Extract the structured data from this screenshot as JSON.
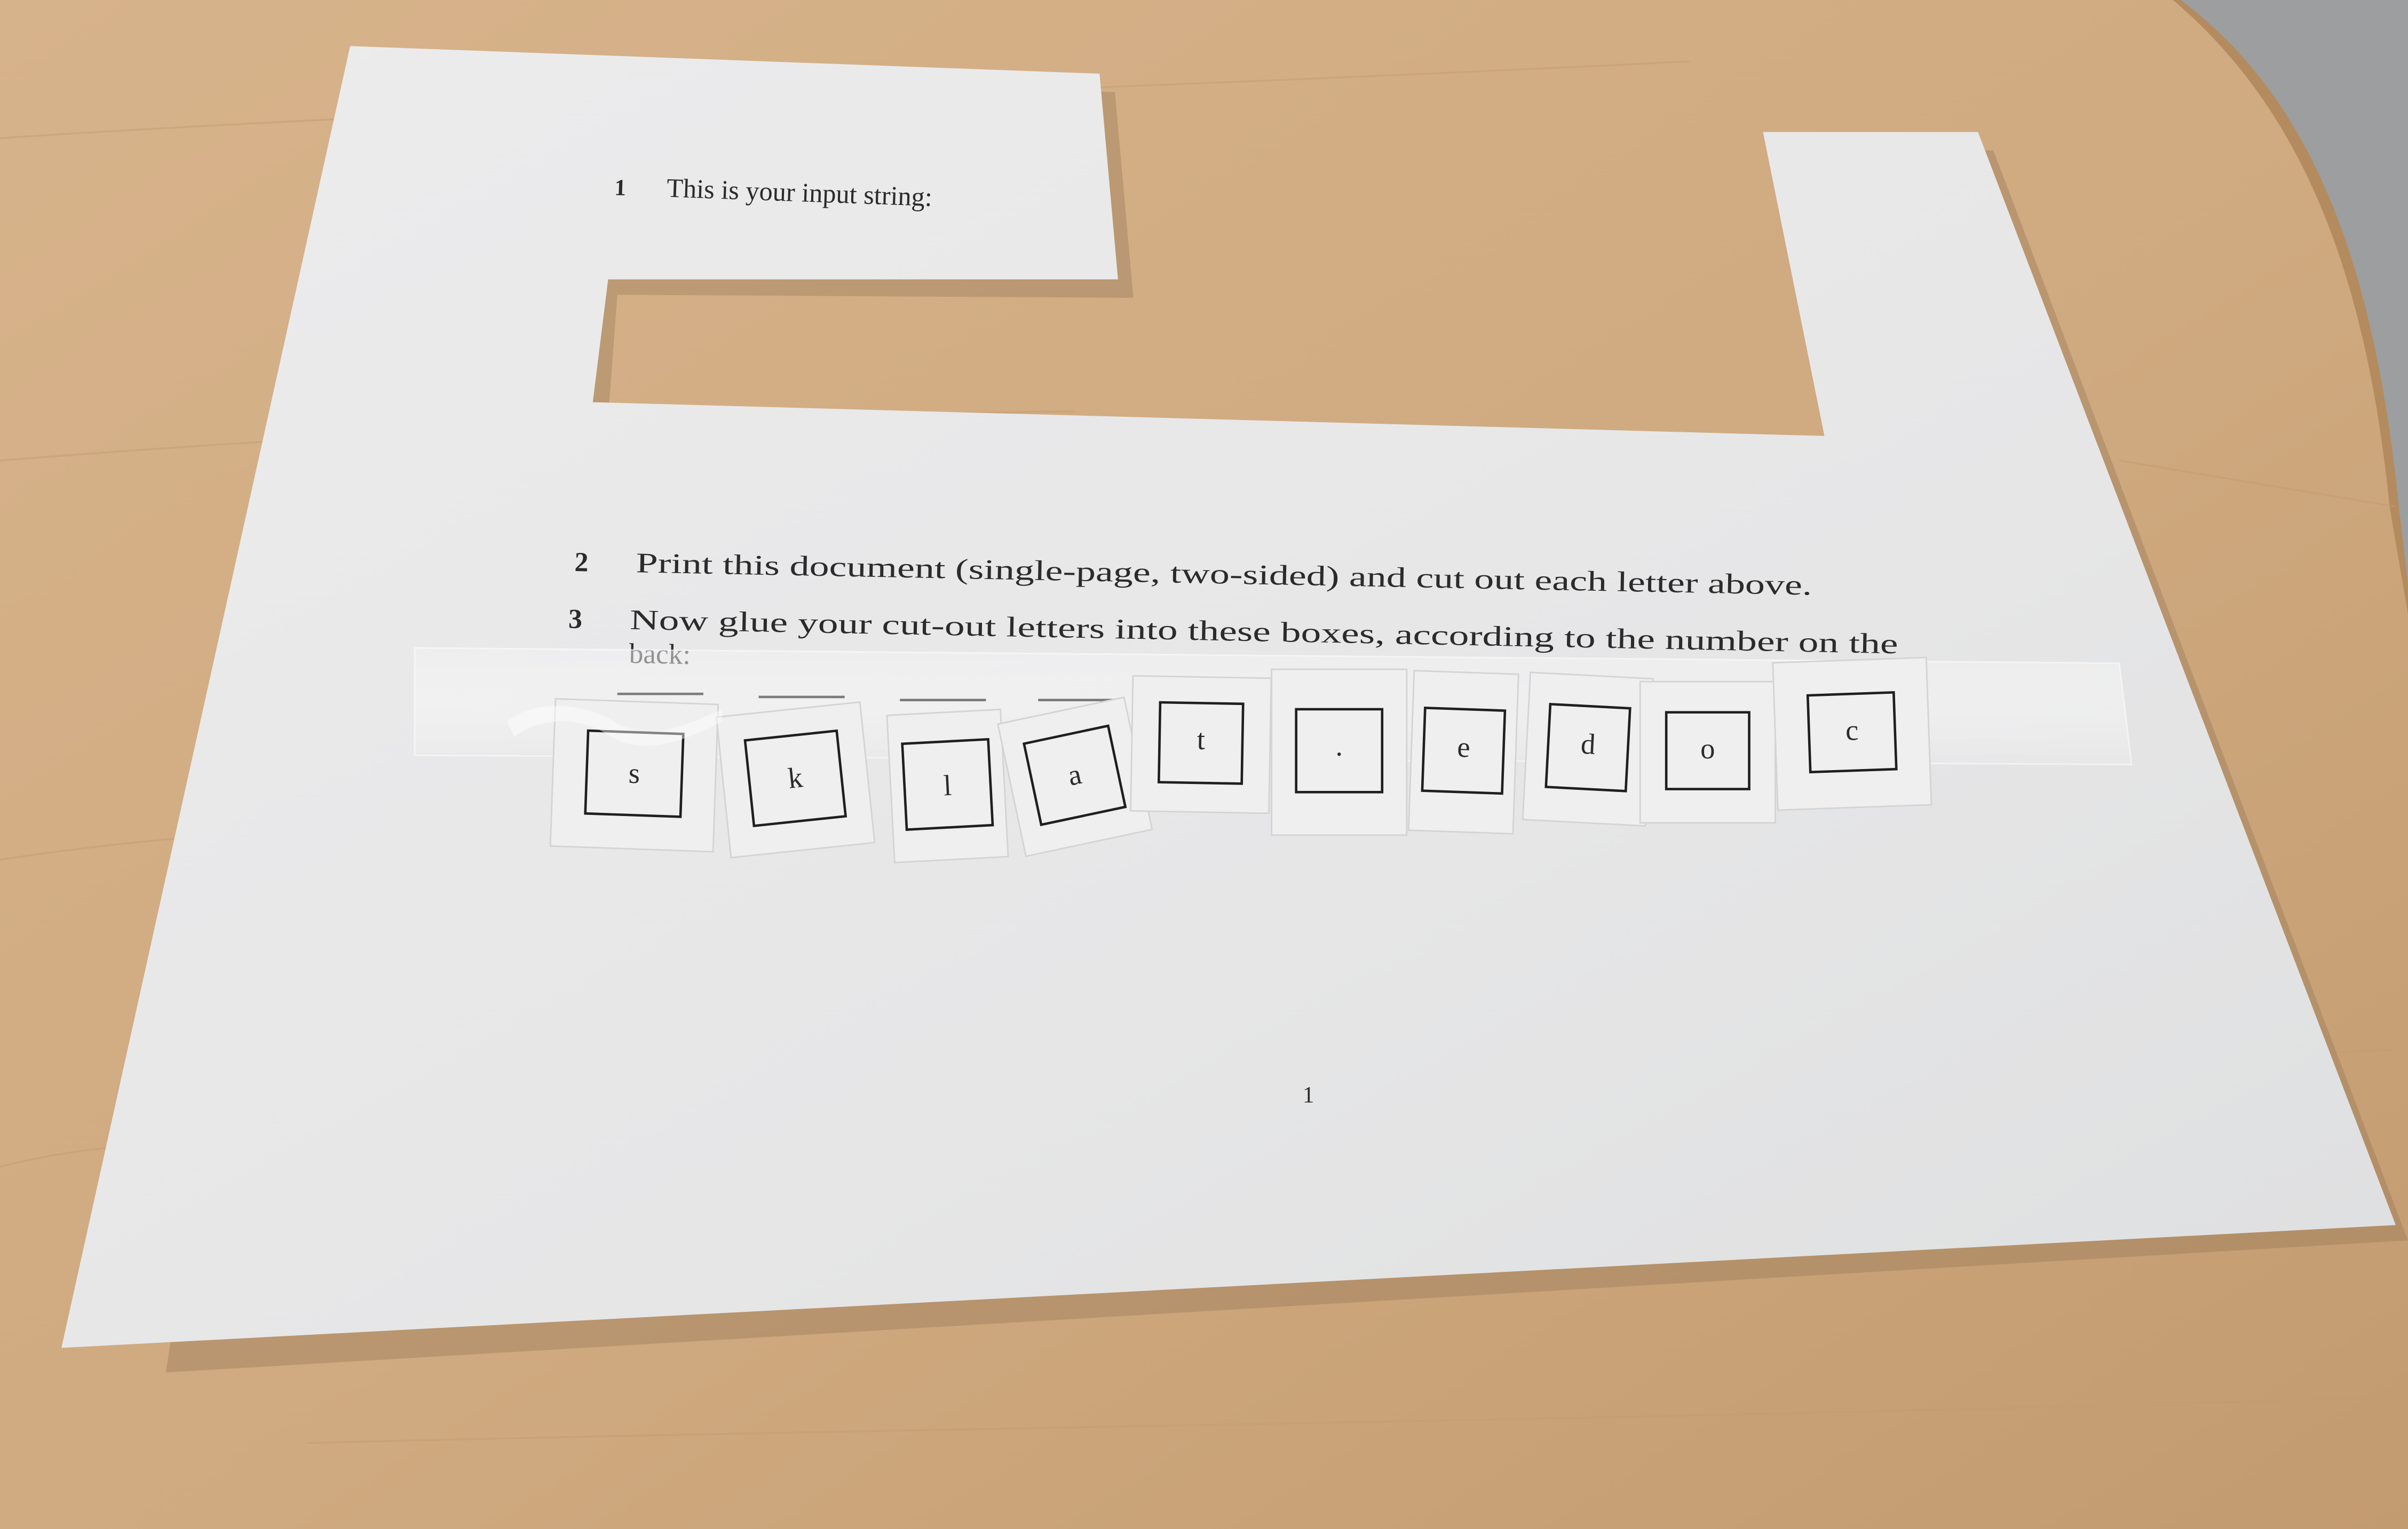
{
  "steps": [
    {
      "number": "1",
      "text": "This is your input string:"
    },
    {
      "number": "2",
      "text": "Print this document (single-page, two-sided) and cut out each letter above."
    },
    {
      "number": "3",
      "text_line1": "Now glue your cut-out letters into these boxes, according to the number on the",
      "text_line2": "back:"
    }
  ],
  "letters": [
    "s",
    "k",
    "l",
    "a",
    "t",
    ".",
    "e",
    "d",
    "o",
    "c"
  ],
  "page_number": "1",
  "colors": {
    "table": "#d2ad85",
    "paper": "#e8e8e9",
    "ink": "#2b2b2b",
    "floor": "#9a9c9e"
  }
}
